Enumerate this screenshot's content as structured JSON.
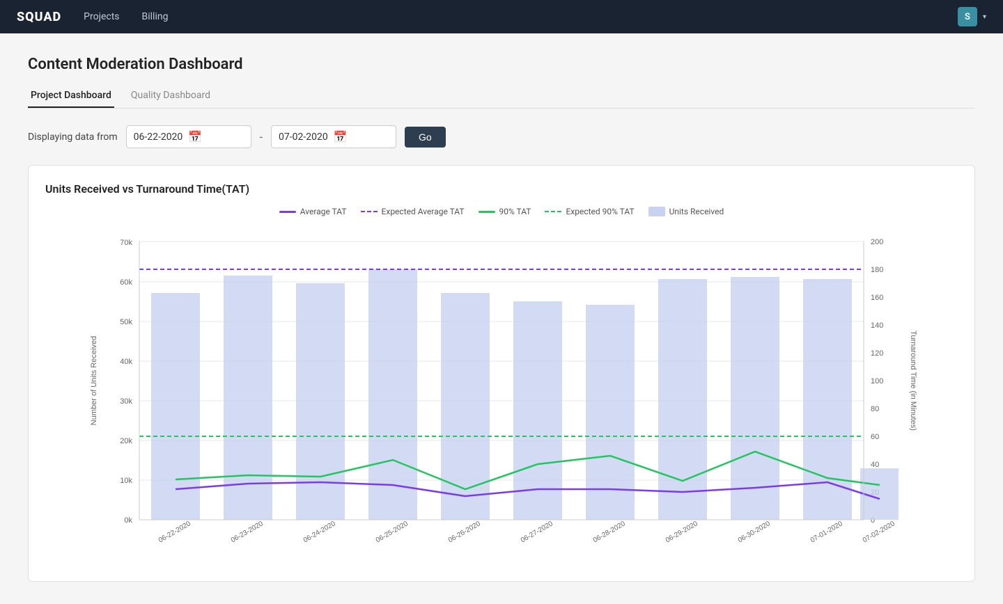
{
  "navbar": {
    "brand": "SQUAD",
    "links": [
      "Projects",
      "Billing"
    ],
    "avatar_letter": "S"
  },
  "page": {
    "title": "Content Moderation Dashboard",
    "tabs": [
      {
        "label": "Project Dashboard",
        "active": true
      },
      {
        "label": "Quality Dashboard",
        "active": false
      }
    ]
  },
  "date_filter": {
    "label": "Displaying data from",
    "from": "06-22-2020",
    "to": "07-02-2020",
    "go_label": "Go"
  },
  "chart": {
    "title": "Units Received vs Turnaround Time(TAT)",
    "legend": [
      {
        "type": "line-solid",
        "color": "#7c3aed",
        "label": "Average TAT"
      },
      {
        "type": "line-dashed",
        "color": "#7c3aed",
        "label": "Expected Average TAT"
      },
      {
        "type": "line-solid",
        "color": "#22c55e",
        "label": "90% TAT"
      },
      {
        "type": "line-dashed",
        "color": "#22c55e",
        "label": "Expected 90% TAT"
      },
      {
        "type": "rect",
        "color": "#c7d2f0",
        "label": "Units Received"
      }
    ],
    "x_labels": [
      "06-22-2020",
      "06-23-2020",
      "06-24-2020",
      "06-25-2020",
      "06-26-2020",
      "06-27-2020",
      "06-28-2020",
      "06-29-2020",
      "06-30-2020",
      "07-01-2020",
      "07-02-2020"
    ],
    "y_left_labels": [
      "0k",
      "10k",
      "20k",
      "30k",
      "40k",
      "50k",
      "60k",
      "70k"
    ],
    "y_right_labels": [
      "0",
      "20",
      "40",
      "60",
      "80",
      "100",
      "120",
      "140",
      "160",
      "180",
      "200"
    ],
    "bars": [
      57000,
      61500,
      59500,
      63000,
      57000,
      55000,
      54000,
      60500,
      61000,
      60500,
      13000
    ],
    "avg_tat": [
      22,
      26,
      27,
      25,
      17,
      22,
      22,
      20,
      23,
      27,
      15
    ],
    "tat_90": [
      29,
      32,
      31,
      43,
      22,
      40,
      46,
      28,
      49,
      30,
      25
    ],
    "expected_avg_tat": 180,
    "expected_90_tat": 60
  }
}
